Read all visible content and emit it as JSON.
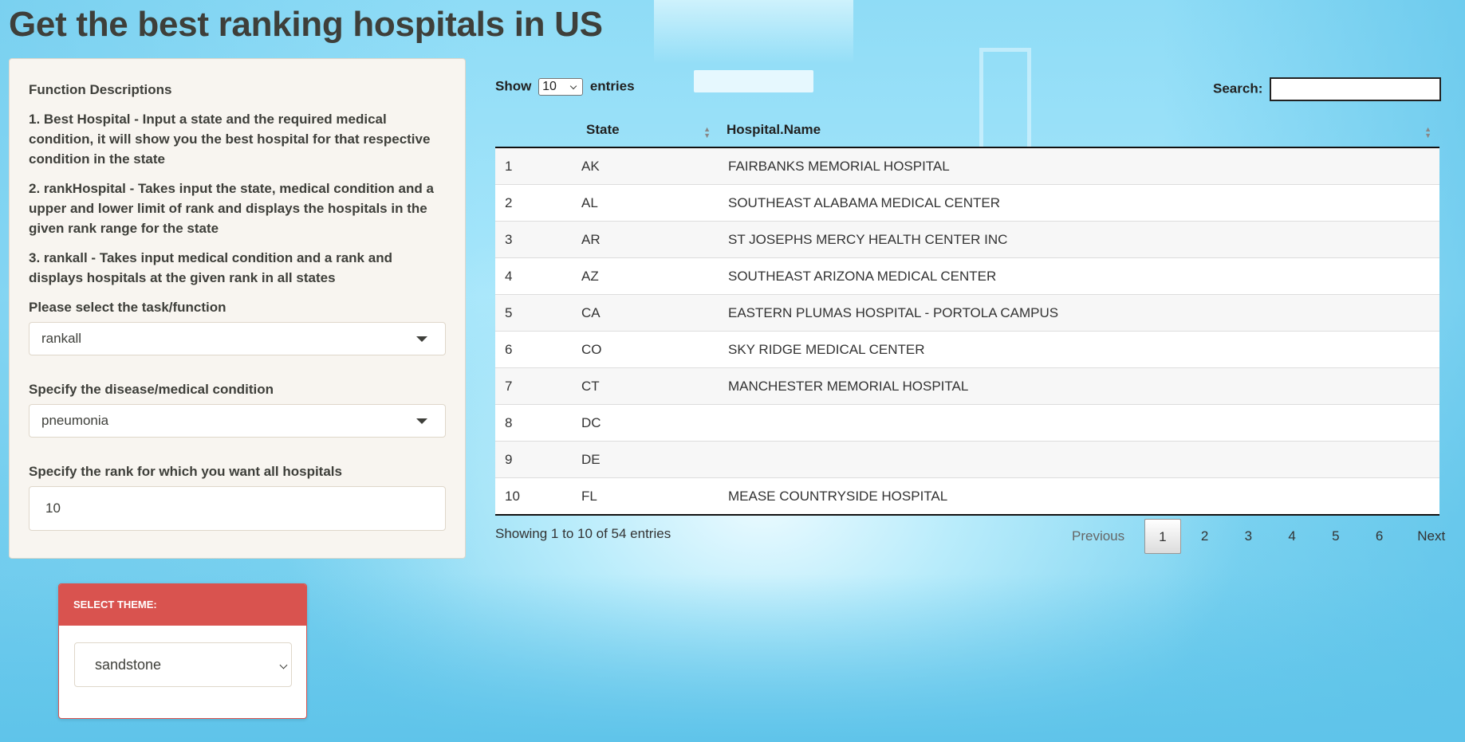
{
  "page": {
    "title": "Get the best ranking hospitals in US"
  },
  "sidebar": {
    "descriptions_title": "Function Descriptions",
    "descriptions": [
      "1. Best Hospital - Input a state and the required medical condition, it will show you the best hospital for that respective condition in the state",
      "2. rankHospital - Takes input the state, medical condition and a upper and lower limit of rank and displays the hospitals in the given rank range for the state",
      "3. rankall - Takes input medical condition and a rank and displays hospitals at the given rank in all states"
    ],
    "task_label": "Please select the task/function",
    "task_value": "rankall",
    "condition_label": "Specify the disease/medical condition",
    "condition_value": "pneumonia",
    "rank_label": "Specify the rank for which you want all hospitals",
    "rank_value": "10"
  },
  "theme": {
    "header": "SELECT THEME:",
    "value": "sandstone"
  },
  "datatable": {
    "show_label": "Show",
    "entries_label": "entries",
    "page_length": "10",
    "search_label": "Search:",
    "search_value": "",
    "columns": [
      "",
      "State",
      "Hospital.Name"
    ],
    "rows": [
      [
        "1",
        "AK",
        "FAIRBANKS MEMORIAL HOSPITAL"
      ],
      [
        "2",
        "AL",
        "SOUTHEAST ALABAMA MEDICAL CENTER"
      ],
      [
        "3",
        "AR",
        "ST JOSEPHS MERCY HEALTH CENTER INC"
      ],
      [
        "4",
        "AZ",
        "SOUTHEAST ARIZONA MEDICAL CENTER"
      ],
      [
        "5",
        "CA",
        "EASTERN PLUMAS HOSPITAL - PORTOLA CAMPUS"
      ],
      [
        "6",
        "CO",
        "SKY RIDGE MEDICAL CENTER"
      ],
      [
        "7",
        "CT",
        "MANCHESTER MEMORIAL HOSPITAL"
      ],
      [
        "8",
        "DC",
        ""
      ],
      [
        "9",
        "DE",
        ""
      ],
      [
        "10",
        "FL",
        "MEASE COUNTRYSIDE HOSPITAL"
      ]
    ],
    "info": "Showing 1 to 10 of 54 entries",
    "pagination": {
      "previous": "Previous",
      "pages": [
        "1",
        "2",
        "3",
        "4",
        "5",
        "6"
      ],
      "current": "1",
      "next": "Next"
    }
  },
  "colors": {
    "theme_header": "#d9534f",
    "sidebar_bg": "#f8f5f0",
    "text": "#3e3f3a"
  }
}
